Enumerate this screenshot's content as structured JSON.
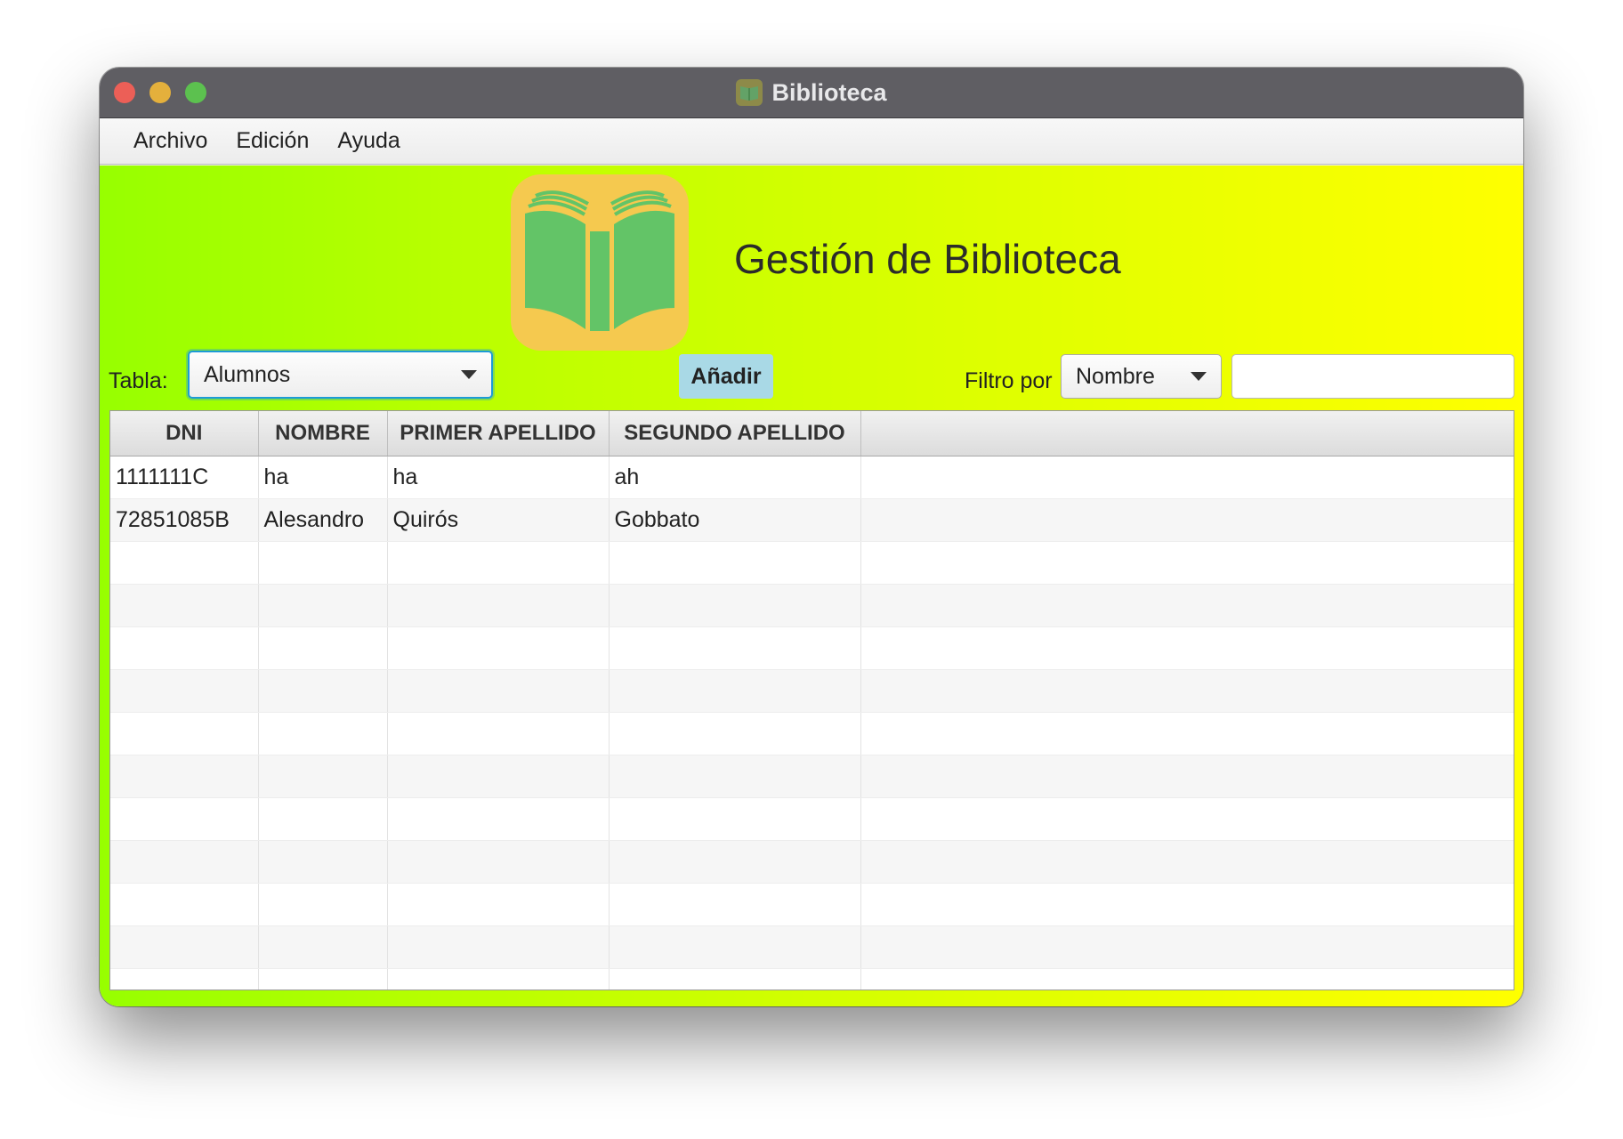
{
  "window": {
    "title": "Biblioteca",
    "controls": [
      "close-button",
      "minimize-button",
      "maximize-button"
    ]
  },
  "menu": {
    "items": [
      "Archivo",
      "Edición",
      "Ayuda"
    ]
  },
  "header": {
    "title": "Gestión de Biblioteca",
    "logo_icon": "open-book-icon",
    "colors": {
      "gradient_start": "#97ff00",
      "gradient_end": "#ffff00",
      "logo_bg": "#f5c94f",
      "book_green": "#63c467"
    }
  },
  "toolbar": {
    "table_label": "Tabla:",
    "table_select_value": "Alumnos",
    "add_button": "Añadir",
    "filter_label": "Filtro por",
    "filter_select_value": "Nombre",
    "filter_input_value": "",
    "filter_input_placeholder": ""
  },
  "table": {
    "columns": [
      "DNI",
      "NOMBRE",
      "PRIMER APELLIDO",
      "SEGUNDO APELLIDO",
      ""
    ],
    "rows": [
      [
        "1111111C",
        "ha",
        "ha",
        "ah",
        ""
      ],
      [
        "72851085B",
        "Alesandro",
        "Quirós",
        "Gobbato",
        ""
      ],
      [
        "",
        "",
        "",
        "",
        ""
      ],
      [
        "",
        "",
        "",
        "",
        ""
      ],
      [
        "",
        "",
        "",
        "",
        ""
      ],
      [
        "",
        "",
        "",
        "",
        ""
      ],
      [
        "",
        "",
        "",
        "",
        ""
      ],
      [
        "",
        "",
        "",
        "",
        ""
      ],
      [
        "",
        "",
        "",
        "",
        ""
      ],
      [
        "",
        "",
        "",
        "",
        ""
      ],
      [
        "",
        "",
        "",
        "",
        ""
      ],
      [
        "",
        "",
        "",
        "",
        ""
      ],
      [
        "",
        "",
        "",
        "",
        ""
      ]
    ]
  }
}
